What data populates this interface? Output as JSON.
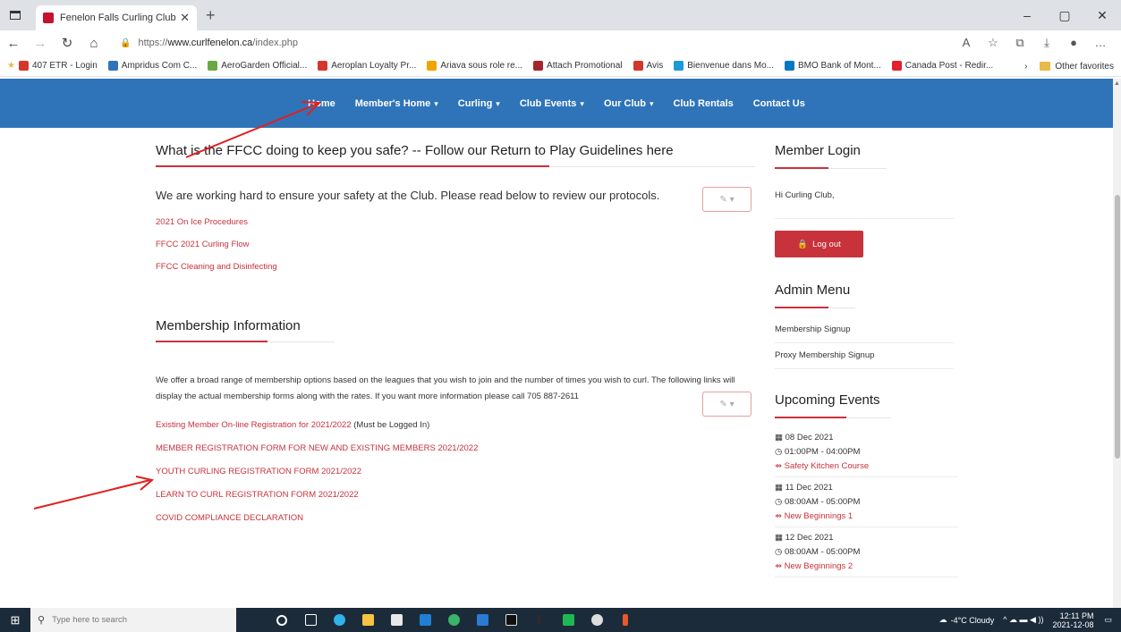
{
  "browser": {
    "tab_title": "Fenelon Falls Curling Club - Hom",
    "tab_close": "✕",
    "new_tab": "+",
    "url_prefix": "https://",
    "url_host": "www.curlfenelon.ca",
    "url_path": "/index.php",
    "win_minimize": "–",
    "win_maximize": "▢",
    "win_close": "✕",
    "bookmarks": [
      {
        "label": "407 ETR - Login",
        "color": "#d2372a"
      },
      {
        "label": "Ampridus Com C...",
        "color": "#2f74b9"
      },
      {
        "label": "AeroGarden Official...",
        "color": "#6aa843"
      },
      {
        "label": "Aeroplan Loyalty Pr...",
        "color": "#d2372a"
      },
      {
        "label": "Ariava sous role re...",
        "color": "#f0a400"
      },
      {
        "label": "Attach Promotional",
        "color": "#a4262c"
      },
      {
        "label": "Avis",
        "color": "#d2372a"
      },
      {
        "label": "Bienvenue dans Mo...",
        "color": "#1a9ad6"
      },
      {
        "label": "BMO Bank of Mont...",
        "color": "#0079c1"
      },
      {
        "label": "Canada Post - Redir...",
        "color": "#e4202e"
      }
    ],
    "bookmarks_more": "›",
    "other_favorites": "Other favorites"
  },
  "nav": {
    "items": [
      {
        "label": "Home",
        "caret": ""
      },
      {
        "label": "Member's Home",
        "caret": "▾"
      },
      {
        "label": "Curling",
        "caret": "▾"
      },
      {
        "label": "Club Events",
        "caret": "▾"
      },
      {
        "label": "Our Club",
        "caret": "▾"
      },
      {
        "label": "Club Rentals",
        "caret": ""
      },
      {
        "label": "Contact Us",
        "caret": ""
      }
    ]
  },
  "safety": {
    "heading": "What is the FFCC doing to keep you safe? -- Follow our Return to Play Guidelines here",
    "intro": "We are working hard to ensure your safety at the Club.  Please read below to review our protocols.",
    "links": [
      "2021 On Ice Procedures",
      "FFCC 2021 Curling Flow",
      "FFCC Cleaning and Disinfecting"
    ],
    "edit_label": "✎ ▾"
  },
  "membership": {
    "heading": "Membership Information",
    "body": "We offer a broad range of membership options based on the leagues that you wish to join and the number of times you wish to curl. The following links will display the actual membership forms along with the rates. If you want more information please call 705 887-2611",
    "existing_link": "Existing Member On-line Registration for 2021/2022",
    "existing_note": "(Must be Logged In)",
    "links": [
      "MEMBER REGISTRATION FORM FOR NEW AND EXISTING MEMBERS 2021/2022",
      "YOUTH CURLING REGISTRATION FORM 2021/2022",
      "LEARN TO CURL REGISTRATION FORM 2021/2022",
      "COVID COMPLIANCE DECLARATION"
    ],
    "edit_label": "✎ ▾"
  },
  "sidebar": {
    "login_title": "Member Login",
    "greeting": "Hi Curling Club,",
    "logout_label": "Log out",
    "admin_title": "Admin Menu",
    "admin_links": [
      "Membership Signup",
      "Proxy Membership Signup"
    ],
    "events_title": "Upcoming Events",
    "events": [
      {
        "date": "08 Dec 2021",
        "time": "01:00PM - 04:00PM",
        "name": "Safety Kitchen Course"
      },
      {
        "date": "11 Dec 2021",
        "time": "08:00AM - 05:00PM",
        "name": "New Beginnings 1"
      },
      {
        "date": "12 Dec 2021",
        "time": "08:00AM - 05:00PM",
        "name": "New Beginnings 2"
      }
    ]
  },
  "taskbar": {
    "search_placeholder": "Type here to search",
    "weather": "-4°C Cloudy",
    "time": "12:11 PM",
    "date": "2021-12-08"
  }
}
